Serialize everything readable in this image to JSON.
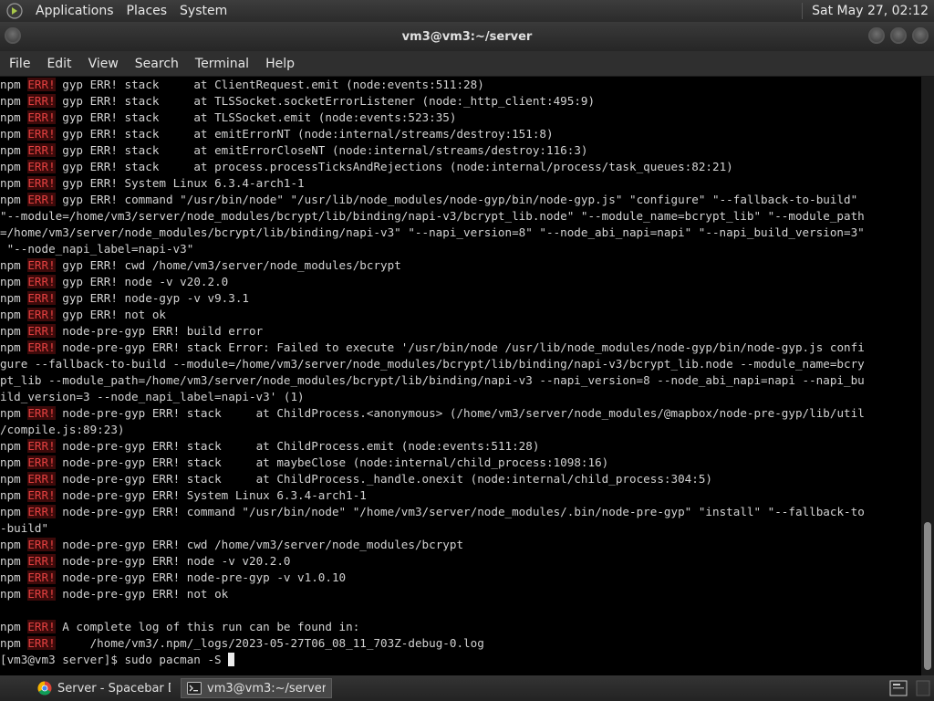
{
  "top_panel": {
    "menus": [
      "Applications",
      "Places",
      "System"
    ],
    "clock": "Sat May 27, 02:12"
  },
  "window": {
    "title": "vm3@vm3:~/server",
    "menu": [
      "File",
      "Edit",
      "View",
      "Search",
      "Terminal",
      "Help"
    ]
  },
  "terminal": {
    "lines": [
      {
        "npm": "npm",
        "err": "ERR!",
        "text": " gyp ERR! stack     at ClientRequest.emit (node:events:511:28)"
      },
      {
        "npm": "npm",
        "err": "ERR!",
        "text": " gyp ERR! stack     at TLSSocket.socketErrorListener (node:_http_client:495:9)"
      },
      {
        "npm": "npm",
        "err": "ERR!",
        "text": " gyp ERR! stack     at TLSSocket.emit (node:events:523:35)"
      },
      {
        "npm": "npm",
        "err": "ERR!",
        "text": " gyp ERR! stack     at emitErrorNT (node:internal/streams/destroy:151:8)"
      },
      {
        "npm": "npm",
        "err": "ERR!",
        "text": " gyp ERR! stack     at emitErrorCloseNT (node:internal/streams/destroy:116:3)"
      },
      {
        "npm": "npm",
        "err": "ERR!",
        "text": " gyp ERR! stack     at process.processTicksAndRejections (node:internal/process/task_queues:82:21)"
      },
      {
        "npm": "npm",
        "err": "ERR!",
        "text": " gyp ERR! System Linux 6.3.4-arch1-1"
      },
      {
        "npm": "npm",
        "err": "ERR!",
        "text": " gyp ERR! command \"/usr/bin/node\" \"/usr/lib/node_modules/node-gyp/bin/node-gyp.js\" \"configure\" \"--fallback-to-build\""
      },
      {
        "npm": "",
        "err": "",
        "text": "\"--module=/home/vm3/server/node_modules/bcrypt/lib/binding/napi-v3/bcrypt_lib.node\" \"--module_name=bcrypt_lib\" \"--module_path"
      },
      {
        "npm": "",
        "err": "",
        "text": "=/home/vm3/server/node_modules/bcrypt/lib/binding/napi-v3\" \"--napi_version=8\" \"--node_abi_napi=napi\" \"--napi_build_version=3\""
      },
      {
        "npm": "",
        "err": "",
        "text": " \"--node_napi_label=napi-v3\""
      },
      {
        "npm": "npm",
        "err": "ERR!",
        "text": " gyp ERR! cwd /home/vm3/server/node_modules/bcrypt"
      },
      {
        "npm": "npm",
        "err": "ERR!",
        "text": " gyp ERR! node -v v20.2.0"
      },
      {
        "npm": "npm",
        "err": "ERR!",
        "text": " gyp ERR! node-gyp -v v9.3.1"
      },
      {
        "npm": "npm",
        "err": "ERR!",
        "text": " gyp ERR! not ok"
      },
      {
        "npm": "npm",
        "err": "ERR!",
        "text": " node-pre-gyp ERR! build error"
      },
      {
        "npm": "npm",
        "err": "ERR!",
        "text": " node-pre-gyp ERR! stack Error: Failed to execute '/usr/bin/node /usr/lib/node_modules/node-gyp/bin/node-gyp.js confi"
      },
      {
        "npm": "",
        "err": "",
        "text": "gure --fallback-to-build --module=/home/vm3/server/node_modules/bcrypt/lib/binding/napi-v3/bcrypt_lib.node --module_name=bcry"
      },
      {
        "npm": "",
        "err": "",
        "text": "pt_lib --module_path=/home/vm3/server/node_modules/bcrypt/lib/binding/napi-v3 --napi_version=8 --node_abi_napi=napi --napi_bu"
      },
      {
        "npm": "",
        "err": "",
        "text": "ild_version=3 --node_napi_label=napi-v3' (1)"
      },
      {
        "npm": "npm",
        "err": "ERR!",
        "text": " node-pre-gyp ERR! stack     at ChildProcess.<anonymous> (/home/vm3/server/node_modules/@mapbox/node-pre-gyp/lib/util"
      },
      {
        "npm": "",
        "err": "",
        "text": "/compile.js:89:23)"
      },
      {
        "npm": "npm",
        "err": "ERR!",
        "text": " node-pre-gyp ERR! stack     at ChildProcess.emit (node:events:511:28)"
      },
      {
        "npm": "npm",
        "err": "ERR!",
        "text": " node-pre-gyp ERR! stack     at maybeClose (node:internal/child_process:1098:16)"
      },
      {
        "npm": "npm",
        "err": "ERR!",
        "text": " node-pre-gyp ERR! stack     at ChildProcess._handle.onexit (node:internal/child_process:304:5)"
      },
      {
        "npm": "npm",
        "err": "ERR!",
        "text": " node-pre-gyp ERR! System Linux 6.3.4-arch1-1"
      },
      {
        "npm": "npm",
        "err": "ERR!",
        "text": " node-pre-gyp ERR! command \"/usr/bin/node\" \"/home/vm3/server/node_modules/.bin/node-pre-gyp\" \"install\" \"--fallback-to"
      },
      {
        "npm": "",
        "err": "",
        "text": "-build\""
      },
      {
        "npm": "npm",
        "err": "ERR!",
        "text": " node-pre-gyp ERR! cwd /home/vm3/server/node_modules/bcrypt"
      },
      {
        "npm": "npm",
        "err": "ERR!",
        "text": " node-pre-gyp ERR! node -v v20.2.0"
      },
      {
        "npm": "npm",
        "err": "ERR!",
        "text": " node-pre-gyp ERR! node-pre-gyp -v v1.0.10"
      },
      {
        "npm": "npm",
        "err": "ERR!",
        "text": " node-pre-gyp ERR! not ok"
      },
      {
        "npm": "",
        "err": "",
        "text": ""
      },
      {
        "npm": "npm",
        "err": "ERR!",
        "text": " A complete log of this run can be found in:"
      },
      {
        "npm": "npm",
        "err": "ERR!",
        "text": "     /home/vm3/.npm/_logs/2023-05-27T06_08_11_703Z-debug-0.log"
      }
    ],
    "prompt": "[vm3@vm3 server]$ sudo pacman -S "
  },
  "taskbar": {
    "tasks": [
      {
        "label": "Server - Spacebar D..."
      },
      {
        "label": "vm3@vm3:~/server"
      }
    ]
  },
  "colors": {
    "err_fg": "#e34040",
    "err_bg": "#3c0a0a",
    "terminal_bg": "#000000",
    "terminal_fg": "#d3d3d3"
  },
  "icons": {
    "applications": "gnome-foot-icon",
    "task_1": "chrome-icon",
    "task_2": "terminal-icon",
    "show_desktop": "show-desktop-icon"
  }
}
